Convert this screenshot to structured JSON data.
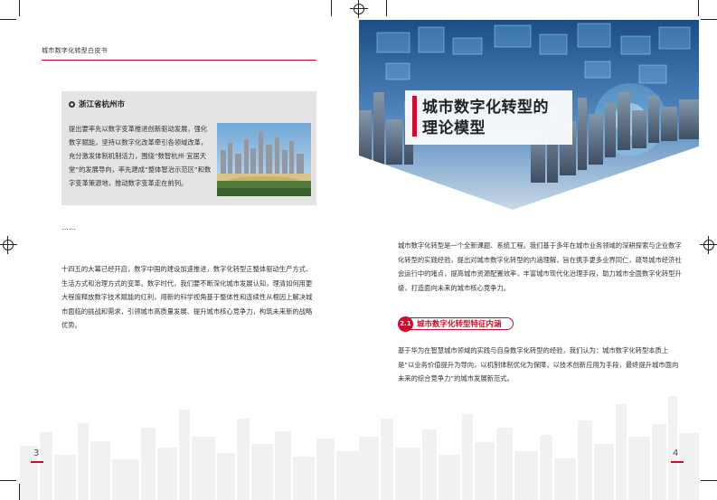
{
  "left_page": {
    "running_head": "城市数字化转型白皮书",
    "case": {
      "title": "浙江省杭州市",
      "text": "提出要率先以数字变革推进创新驱动发展，强化数字赋能，坚持以数字化改革牵引各领域改革，充分激发体制机制活力，围绕“数智杭州·宜居天堂”的发展导向，率先建成“整体智治示范区”和数字变革策源地，推动数字变革走在前列。"
    },
    "ellipsis": "……",
    "paragraph": "十四五的大幕已经开启，数字中国的建设加速推进，数字化转型正整体驱动生产方式、生活方式和治理方式的变革。数字时代，我们要不断深化城市发展认知，理清如何用更大程度释放数字技术赋能的红利，用新的科学视角基于整体性和连续性从根因上解决城市面临的挑战和需求，引领城市高质量发展、提升城市核心竞争力，构筑未来新的战略优势。",
    "page_number": "3"
  },
  "right_page": {
    "title_line1": "城市数字化转型的",
    "title_line2": "理论模型",
    "paragraph1": "城市数字化转型是一个全新课题、系统工程。我们基于多年在城市业务领域的深耕探索与企业数字化转型的实践经验，提出对城市数字化转型的内涵理解，旨在携手更多业界同仁，疏导城市经济社会运行中的堵点，提高城市资源配置效率，丰富城市现代化治理手段，助力城市全面数字化转型升级，打造面向未来的城市核心竞争力。",
    "section": {
      "number": "2.1",
      "label": "城市数字化转型特征内涵"
    },
    "paragraph2": "基于华为在智慧城市领域的实践与自身数字化转型的经验，我们认为：城市数字化转型本质上是“以业务价值提升为导向，以机制体制优化为保障，以技术创新应用为手段，最终提升城市面向未来的综合竞争力”的城市发展新范式。",
    "page_number": "4"
  },
  "colors": {
    "accent": "#c8102e",
    "case_bg": "#e4e4e4"
  }
}
